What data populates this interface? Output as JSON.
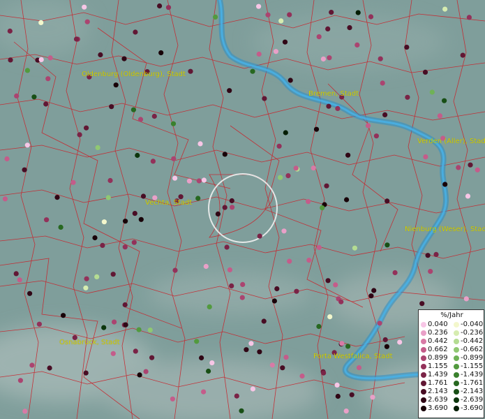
{
  "map": {
    "cities": {
      "oldenburg": "Oldenburg (Oldenburg), Stadt",
      "bremen": "Bremen, Stadt",
      "verden": "Verden (Aller), Stadt",
      "vechta": "Vechta, Stadt",
      "nienburg": "Nienburg (Weser), Stadt",
      "osnabrueck": "Osnabrück, Stadt",
      "porta": "Porta Westfalica, Stadt"
    },
    "colors": {
      "terrain": "#7f9e9b",
      "boundaries": "#c8242c",
      "river": "#2a8fc9",
      "label": "#d4d000",
      "locator_ring": "#f0f0f0"
    }
  },
  "legend": {
    "title": "%/Jahr",
    "positive": [
      {
        "label": "0.040",
        "color": "#f7c6e6"
      },
      {
        "label": "0.236",
        "color": "#e9a0c8"
      },
      {
        "label": "0.442",
        "color": "#d87aa6"
      },
      {
        "label": "0.662",
        "color": "#c45c8a"
      },
      {
        "label": "0.899",
        "color": "#ab4470"
      },
      {
        "label": "1.155",
        "color": "#93315a"
      },
      {
        "label": "1.439",
        "color": "#7a2346"
      },
      {
        "label": "1.761",
        "color": "#611734"
      },
      {
        "label": "2.143",
        "color": "#480d24"
      },
      {
        "label": "2.639",
        "color": "#300615"
      },
      {
        "label": "3.690",
        "color": "#180208"
      }
    ],
    "negative": [
      {
        "label": "-0.040",
        "color": "#f3f7cc"
      },
      {
        "label": "-0.236",
        "color": "#d6ecb0"
      },
      {
        "label": "-0.442",
        "color": "#b4dc92"
      },
      {
        "label": "-0.662",
        "color": "#90c872"
      },
      {
        "label": "-0.899",
        "color": "#6fb256"
      },
      {
        "label": "-1.155",
        "color": "#529a3e"
      },
      {
        "label": "-1.439",
        "color": "#3a812d"
      },
      {
        "label": "-1.761",
        "color": "#276820"
      },
      {
        "label": "-2.143",
        "color": "#184f15"
      },
      {
        "label": "-2.639",
        "color": "#0c360c"
      },
      {
        "label": "-3.690",
        "color": "#041d04"
      }
    ]
  }
}
